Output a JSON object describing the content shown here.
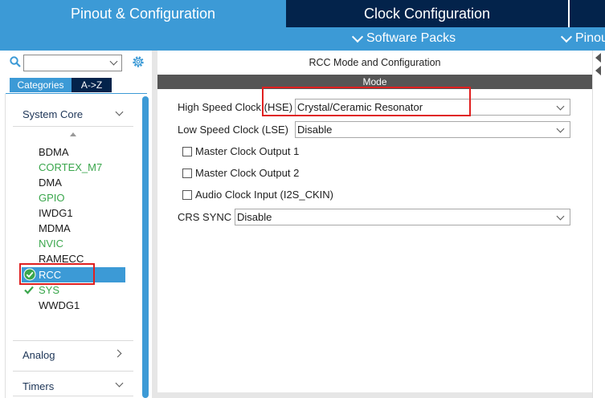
{
  "tabs": {
    "pinout": "Pinout & Configuration",
    "clock": "Clock Configuration"
  },
  "subbar": {
    "software_packs": "Software Packs",
    "pinout_menu": "Pinou"
  },
  "sidebar": {
    "search_value": "",
    "btn_categories": "Categories",
    "btn_az": "A->Z",
    "groups": {
      "system_core": "System Core",
      "analog": "Analog",
      "timers": "Timers"
    },
    "items": [
      {
        "label": "BDMA",
        "color": "dark"
      },
      {
        "label": "CORTEX_M7",
        "color": "green"
      },
      {
        "label": "DMA",
        "color": "dark"
      },
      {
        "label": "GPIO",
        "color": "green"
      },
      {
        "label": "IWDG1",
        "color": "dark"
      },
      {
        "label": "MDMA",
        "color": "dark"
      },
      {
        "label": "NVIC",
        "color": "green"
      },
      {
        "label": "RAMECC",
        "color": "dark"
      },
      {
        "label": "RCC",
        "color": "selected"
      },
      {
        "label": "SYS",
        "color": "green"
      },
      {
        "label": "WWDG1",
        "color": "dark"
      }
    ]
  },
  "main": {
    "title": "RCC Mode and Configuration",
    "mode_header": "Mode",
    "hse_label": "High Speed Clock (HSE)",
    "hse_value": "Crystal/Ceramic Resonator",
    "lse_label": "Low Speed Clock (LSE)",
    "lse_value": "Disable",
    "mco1_label": "Master Clock Output 1",
    "mco2_label": "Master Clock Output 2",
    "audio_label": "Audio Clock Input (I2S_CKIN)",
    "crs_label": "CRS SYNC",
    "crs_value": "Disable"
  },
  "colors": {
    "accent": "#3c9ad6",
    "dark_nav": "#03234b",
    "green": "#3aa64c",
    "highlight_red": "#e02020",
    "mode_bar": "#555555"
  }
}
